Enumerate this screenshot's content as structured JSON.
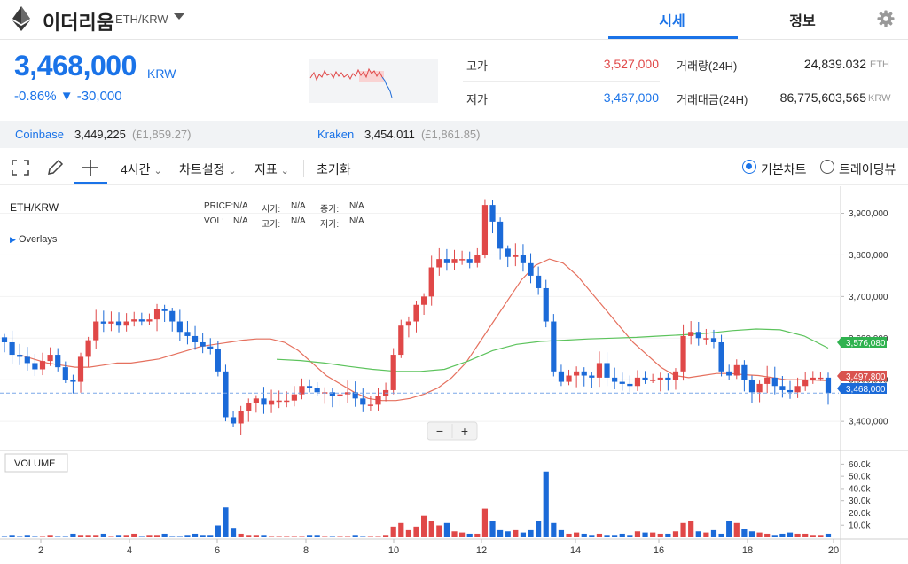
{
  "header": {
    "coin_name": "이더리움",
    "pair": "ETH/KRW",
    "tabs": [
      "시세",
      "정보"
    ]
  },
  "price": {
    "value": "3,468,000",
    "unit": "KRW",
    "change_pct": "-0.86%",
    "change_abs": "▼ -30,000"
  },
  "stats": {
    "high_label": "고가",
    "high_value": "3,527,000",
    "low_label": "저가",
    "low_value": "3,467,000",
    "volume_label": "거래량(24H)",
    "volume_value": "24,839.032",
    "volume_unit": "ETH",
    "turnover_label": "거래대금(24H)",
    "turnover_value": "86,775,603,565",
    "turnover_unit": "KRW"
  },
  "exchanges": [
    {
      "name": "Coinbase",
      "price": "3,449,225",
      "fx": "(£1,859.27)"
    },
    {
      "name": "Kraken",
      "price": "3,454,011",
      "fx": "(£1,861.85)"
    }
  ],
  "toolbar": {
    "interval": "4시간",
    "chart_settings": "차트설정",
    "indicators": "지표",
    "reset": "초기화",
    "basic_chart": "기본차트",
    "tradingview": "트레이딩뷰"
  },
  "chart": {
    "symbol": "ETH/KRW",
    "overlays": "Overlays",
    "info_row1": [
      [
        "PRICE:",
        "N/A"
      ],
      [
        "시가:",
        "N/A"
      ],
      [
        "종가:",
        "N/A"
      ]
    ],
    "info_row2": [
      [
        "VOL:",
        "N/A"
      ],
      [
        "고가:",
        "N/A"
      ],
      [
        "저가:",
        "N/A"
      ]
    ],
    "volume_label": "VOLUME",
    "zoom_minus": "−",
    "zoom_plus": "+",
    "price_badges": {
      "ma_green": "3,576,080",
      "ma_red": "3,497,800",
      "last": "3,468,000"
    }
  },
  "chart_data": {
    "type": "candlestick",
    "x_ticks": [
      "2",
      "4",
      "6",
      "8",
      "10",
      "12",
      "14",
      "16",
      "18",
      "20"
    ],
    "y_ticks": [
      "3,900,000",
      "3,800,000",
      "3,700,000",
      "3,600,000",
      "3,500,000",
      "3,400,000"
    ],
    "volume_ticks": [
      "60.0k",
      "50.0k",
      "40.0k",
      "30.0k",
      "20.0k",
      "10.0k"
    ],
    "ylim": [
      3330000,
      3965000
    ],
    "closes": [
      3590000,
      3560000,
      3555000,
      3540000,
      3525000,
      3545000,
      3560000,
      3530000,
      3500000,
      3495000,
      3555000,
      3595000,
      3640000,
      3635000,
      3640000,
      3630000,
      3640000,
      3645000,
      3640000,
      3645000,
      3670000,
      3665000,
      3640000,
      3615000,
      3605000,
      3590000,
      3580000,
      3575000,
      3520000,
      3410000,
      3395000,
      3425000,
      3445000,
      3455000,
      3440000,
      3450000,
      3450000,
      3450000,
      3465000,
      3485000,
      3480000,
      3470000,
      3470000,
      3460000,
      3465000,
      3470000,
      3455000,
      3440000,
      3440000,
      3460000,
      3475000,
      3560000,
      3630000,
      3640000,
      3680000,
      3700000,
      3770000,
      3790000,
      3780000,
      3790000,
      3790000,
      3780000,
      3800000,
      3920000,
      3880000,
      3815000,
      3795000,
      3800000,
      3780000,
      3750000,
      3720000,
      3640000,
      3520000,
      3495000,
      3510000,
      3520000,
      3510000,
      3505000,
      3540000,
      3505000,
      3495000,
      3490000,
      3485000,
      3505000,
      3500000,
      3500000,
      3505000,
      3500000,
      3520000,
      3605000,
      3615000,
      3600000,
      3600000,
      3590000,
      3520000,
      3510000,
      3535000,
      3500000,
      3470000,
      3490000,
      3505000,
      3485000,
      3475000,
      3470000,
      3485000,
      3500000,
      3505000,
      3505000,
      3468000
    ],
    "volumes": [
      1,
      2,
      1,
      2,
      1,
      1,
      2,
      1,
      1,
      3,
      2,
      2,
      2,
      3,
      1,
      2,
      2,
      3,
      1,
      2,
      2,
      3,
      1,
      1,
      2,
      3,
      2,
      2,
      10,
      25,
      8,
      3,
      2,
      2,
      2,
      1,
      1,
      1,
      1,
      1,
      2,
      2,
      1,
      1,
      1,
      1,
      2,
      1,
      1,
      1,
      2,
      9,
      12,
      6,
      9,
      18,
      14,
      10,
      12,
      5,
      4,
      3,
      3,
      24,
      14,
      6,
      5,
      6,
      4,
      6,
      14,
      55,
      12,
      6,
      3,
      4,
      3,
      2,
      3,
      2,
      2,
      3,
      2,
      5,
      4,
      4,
      3,
      3,
      5,
      12,
      14,
      5,
      4,
      6,
      3,
      14,
      12,
      7,
      5,
      4,
      3,
      2,
      3,
      4,
      3,
      3,
      2,
      2,
      3
    ],
    "ma_red": [
      3560000,
      3550000,
      3540000,
      3535000,
      3530000,
      3530000,
      3535000,
      3540000,
      3540000,
      3545000,
      3550000,
      3560000,
      3570000,
      3580000,
      3585000,
      3590000,
      3595000,
      3598000,
      3598000,
      3590000,
      3570000,
      3540000,
      3510000,
      3490000,
      3470000,
      3455000,
      3450000,
      3450000,
      3455000,
      3465000,
      3480000,
      3505000,
      3540000,
      3590000,
      3640000,
      3690000,
      3740000,
      3775000,
      3790000,
      3780000,
      3750000,
      3710000,
      3670000,
      3630000,
      3590000,
      3560000,
      3530000,
      3510000,
      3505000,
      3510000,
      3515000,
      3515000,
      3512000,
      3510000,
      3505000,
      3500000,
      3500000,
      3499000,
      3497800
    ],
    "ma_green": [
      3549000,
      3546000,
      3540000,
      3532000,
      3525000,
      3520000,
      3520000,
      3525000,
      3545000,
      3570000,
      3585000,
      3592000,
      3595000,
      3598000,
      3600000,
      3602000,
      3605000,
      3608000,
      3612000,
      3618000,
      3622000,
      3620000,
      3605000,
      3576080
    ]
  },
  "colors": {
    "up": "#e04848",
    "down": "#1b6ad8",
    "accent": "#1a73e8",
    "ma_red": "#e5705e",
    "ma_green": "#5cc35c"
  }
}
